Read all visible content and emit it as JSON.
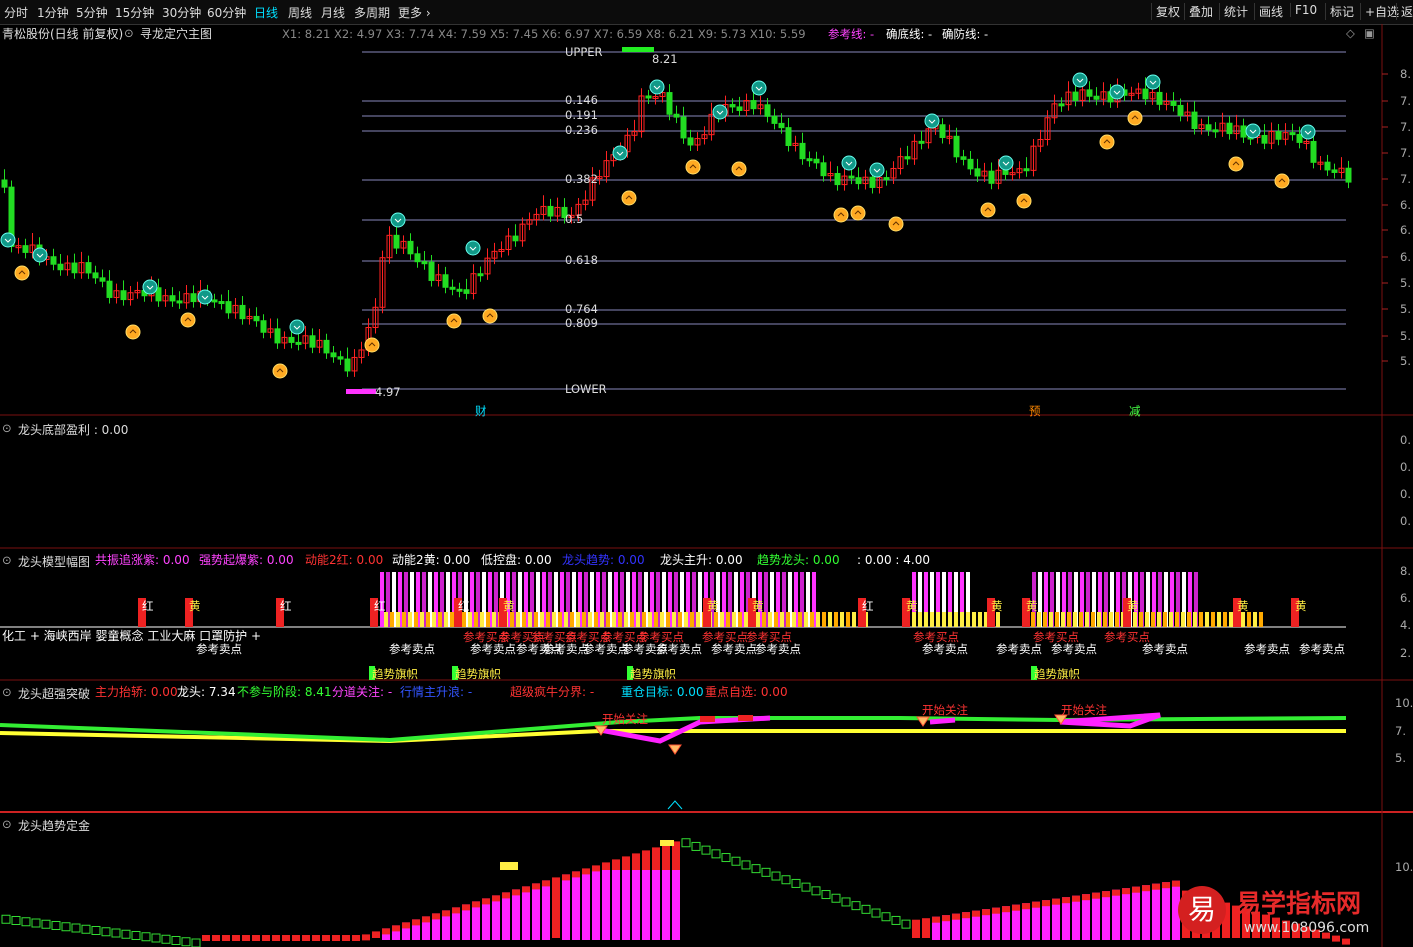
{
  "periods": [
    "分时",
    "1分钟",
    "5分钟",
    "15分钟",
    "30分钟",
    "60分钟",
    "日线",
    "周线",
    "月线",
    "多周期",
    "更多 ›"
  ],
  "active_period": "日线",
  "toolbar_right": [
    "复权",
    "叠加",
    "统计",
    "画线",
    "F10",
    "标记",
    "+自选",
    "返"
  ],
  "main": {
    "stock": "青松股份(日线 前复权)",
    "indicator": "寻龙定穴主图",
    "xlabels": "X1: 8.21  X2: 4.97  X3: 7.74  X4: 7.59  X5: 7.45  X6: 6.97  X7: 6.59  X8: 6.21  X9: 5.73  X10: 5.59",
    "ref_line": "参考线: -",
    "bottom_line": "确底线: -",
    "defense_line": "确防线: -",
    "upper": "UPPER",
    "lower": "LOWER",
    "high_mark": "8.21",
    "low_mark": "4.97",
    "fib": [
      "0.146",
      "0.191",
      "0.236",
      "0.382",
      "0.5",
      "0.618",
      "0.764",
      "0.809"
    ],
    "events": [
      "财",
      "预",
      "减"
    ],
    "axis": [
      "8.",
      "7.",
      "7.",
      "7.",
      "7.",
      "6.",
      "6.",
      "6.",
      "5.",
      "5.",
      "5.",
      "5."
    ]
  },
  "p2": {
    "title": "龙头底部盈利 : 0.00",
    "axis": [
      "0.",
      "0.",
      "0.",
      "0."
    ]
  },
  "p3": {
    "title": "龙头模型幅图",
    "items": [
      {
        "label": "共振追涨紫: 0.00",
        "color": "#ff44ff"
      },
      {
        "label": "强势起爆紫: 0.00",
        "color": "#ff44ff"
      },
      {
        "label": "动能2红: 0.00",
        "color": "#ff3333"
      },
      {
        "label": "动能2黄: 0.00",
        "color": "#ffffff"
      },
      {
        "label": "低控盘: 0.00",
        "color": "#ffffff"
      },
      {
        "label": "龙头趋势: 0.00",
        "color": "#3333ff"
      },
      {
        "label": "龙头主升: 0.00",
        "color": "#ffffff"
      },
      {
        "label": "趋势龙头: 0.00",
        "color": "#33ff33"
      },
      {
        "label": ": 0.00 : 4.00",
        "color": "#ffffff"
      }
    ],
    "left_text": "化工 + 海峡西岸 婴童概念 工业大麻 口罩防护 +",
    "buy": "参考买点",
    "sell": "参考卖点",
    "red_tag": "红",
    "yellow_tag": "黄",
    "flag": "趋势旗帜",
    "axis": [
      "8.",
      "6.",
      "4.",
      "2."
    ]
  },
  "p4": {
    "title": "龙头超强突破",
    "items": [
      {
        "label": "主力抬轿: 0.00",
        "color": "#ff3333"
      },
      {
        "label": "龙头: 7.34",
        "color": "#ffffff"
      },
      {
        "label": "不参与阶段: 8.41",
        "color": "#33ff33"
      },
      {
        "label": "分道关注: -",
        "color": "#ff44ff"
      },
      {
        "label": "行情主升浪: -",
        "color": "#3355ff"
      },
      {
        "label": "超级疯牛分界: -",
        "color": "#ff3333"
      },
      {
        "label": "重仓目标: 0.00",
        "color": "#00e0ff"
      },
      {
        "label": "重点自选: 0.00",
        "color": "#ff3333"
      }
    ],
    "attention": "开始关注",
    "axis": [
      "10.",
      "7.",
      "5."
    ]
  },
  "p5": {
    "title": "龙头趋势定金",
    "axis": [
      "10."
    ]
  },
  "watermark": {
    "logo": "易",
    "name": "易学指标网",
    "url": "www.108096.com"
  },
  "colors": {
    "up": "#ff2222",
    "down": "#22dd22",
    "magenta": "#ff00ff",
    "yellow": "#ffff44",
    "cyan": "#00e0ff"
  }
}
